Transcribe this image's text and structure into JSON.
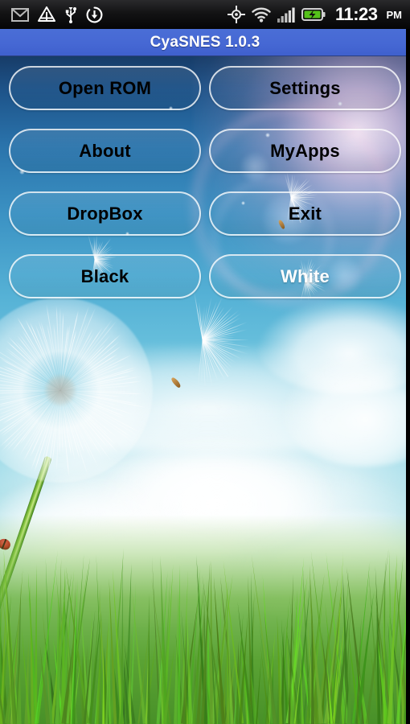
{
  "status_bar": {
    "icons_left": [
      {
        "name": "gmail-icon",
        "label": "Gmail new mail"
      },
      {
        "name": "android-alert-icon",
        "label": "Android notification"
      },
      {
        "name": "usb-icon",
        "label": "USB connected"
      },
      {
        "name": "download-sync-icon",
        "label": "Downloading"
      }
    ],
    "icons_right": [
      {
        "name": "gps-crosshair-icon",
        "label": "GPS active"
      },
      {
        "name": "wifi-icon",
        "label": "Wi-Fi connected"
      },
      {
        "name": "signal-bars-icon",
        "label": "Cellular signal"
      },
      {
        "name": "battery-charging-icon",
        "label": "Battery charging"
      }
    ],
    "time": "11:23",
    "ampm": "PM"
  },
  "title_bar": {
    "title": "CyaSNES 1.0.3",
    "background_color": "#4a6ed6",
    "text_color": "#ffffff"
  },
  "buttons": {
    "rows": [
      [
        {
          "id": "open-rom",
          "label": "Open ROM",
          "text_color": "#000000"
        },
        {
          "id": "settings",
          "label": "Settings",
          "text_color": "#000000"
        }
      ],
      [
        {
          "id": "about",
          "label": "About",
          "text_color": "#000000"
        },
        {
          "id": "myapps",
          "label": "MyApps",
          "text_color": "#000000"
        }
      ],
      [
        {
          "id": "dropbox",
          "label": "DropBox",
          "text_color": "#000000"
        },
        {
          "id": "exit",
          "label": "Exit",
          "text_color": "#000000"
        }
      ],
      [
        {
          "id": "black",
          "label": "Black",
          "text_color": "#000000"
        },
        {
          "id": "white",
          "label": "White",
          "text_color": "#ffffff"
        }
      ]
    ]
  },
  "wallpaper": {
    "name": "dandelion-sky-grass-wallpaper",
    "sky_color": "#56b2d6",
    "grass_color": "#5aa02e",
    "flare_color": "#f8cde8"
  }
}
